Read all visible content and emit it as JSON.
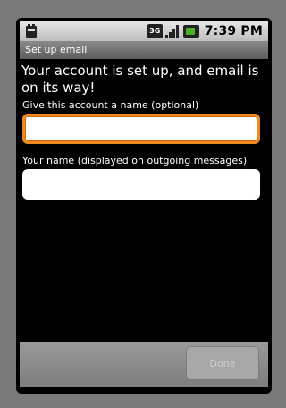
{
  "status_bar": {
    "network_type": "3G",
    "time": "7:39 PM",
    "icons": [
      "download-notification-icon",
      "3g-icon",
      "signal-strength-icon",
      "battery-icon"
    ]
  },
  "title_bar": {
    "title": "Set up email"
  },
  "main": {
    "headline": "Your account is set up, and email is on its way!",
    "account_name": {
      "label": "Give this account a name (optional)",
      "value": "",
      "placeholder": ""
    },
    "your_name": {
      "label": "Your name (displayed on outgoing messages)",
      "value": "",
      "placeholder": ""
    }
  },
  "footer": {
    "done_label": "Done"
  },
  "colors": {
    "focus_border": "#f08a1c",
    "battery_fill": "#4caf28",
    "screen_background": "#000000"
  }
}
